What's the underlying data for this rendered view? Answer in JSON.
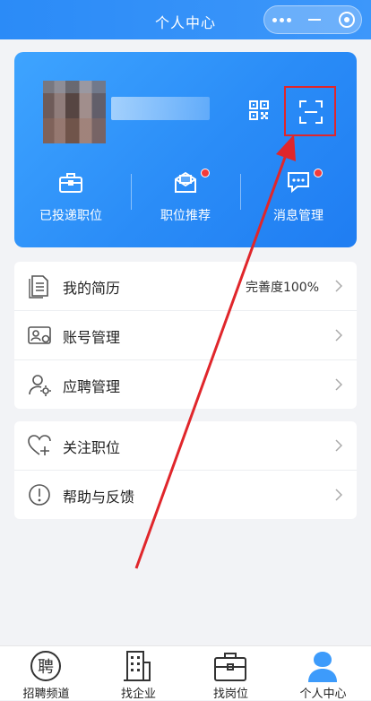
{
  "header": {
    "title": "个人中心"
  },
  "colors": {
    "brand": "#2b8bf7",
    "highlight": "#e0262b",
    "badge": "#f23b3b"
  },
  "profile": {
    "quick_actions": [
      {
        "label": "已投递职位",
        "icon": "briefcase-icon"
      },
      {
        "label": "职位推荐",
        "icon": "recommend-mail-icon"
      },
      {
        "label": "消息管理",
        "icon": "message-icon"
      }
    ]
  },
  "menu_group1": [
    {
      "label": "我的简历",
      "right": "完善度100%",
      "icon": "resume-icon"
    },
    {
      "label": "账号管理",
      "icon": "account-card-icon"
    },
    {
      "label": "应聘管理",
      "icon": "user-settings-icon"
    }
  ],
  "menu_group2": [
    {
      "label": "关注职位",
      "icon": "heart-plus-icon"
    },
    {
      "label": "帮助与反馈",
      "icon": "help-icon"
    }
  ],
  "tabs": [
    {
      "label": "招聘频道",
      "icon": "recruit-channel-icon",
      "glyph": "聘"
    },
    {
      "label": "找企业",
      "icon": "building-icon"
    },
    {
      "label": "找岗位",
      "icon": "job-bag-icon"
    },
    {
      "label": "个人中心",
      "icon": "person-icon",
      "active": true
    }
  ]
}
